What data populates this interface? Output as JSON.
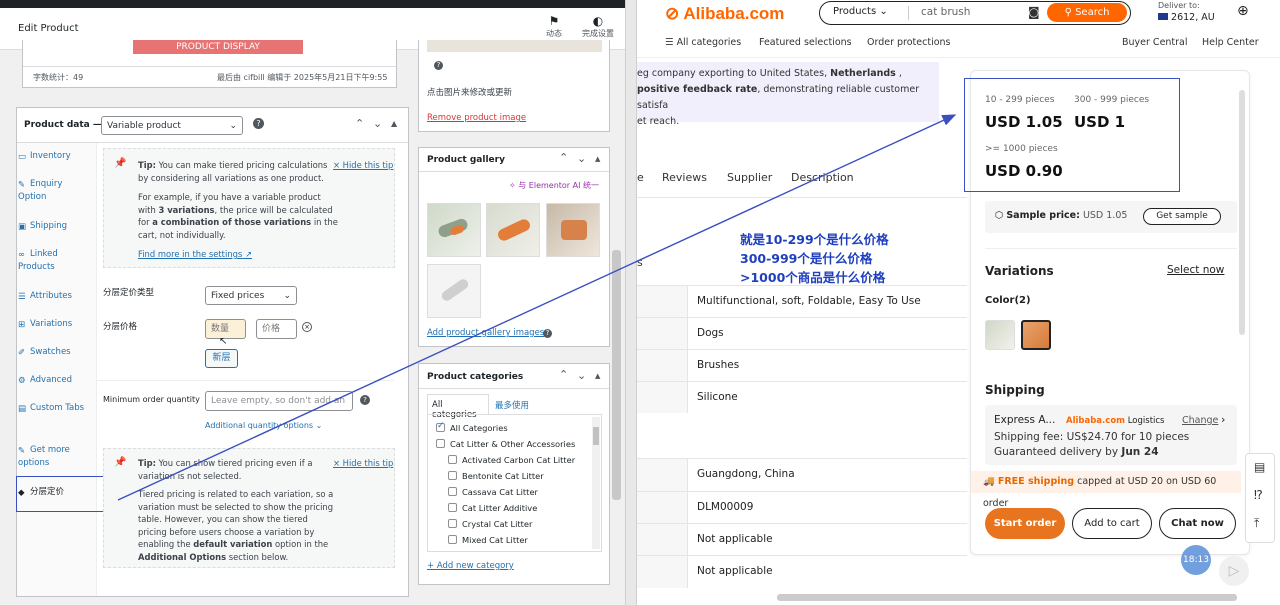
{
  "wp": {
    "header_title": "Edit Product",
    "header_actions": [
      "动态",
      "完成设置"
    ],
    "word_count": "字数统计：49",
    "last_edit": "最后由 cifbill 编辑于 2025年5月21日下午9:55",
    "banner_text": "PRODUCT DISPLAY",
    "product_data_label": "Product data —",
    "product_type": "Variable product",
    "tabs": [
      "Inventory",
      "Enquiry Option",
      "Shipping",
      "Linked Products",
      "Attributes",
      "Variations",
      "Swatches",
      "Advanced",
      "Custom Tabs",
      "Get more options",
      "分层定价"
    ],
    "tip1": {
      "prefix": "Tip:",
      "text": "You can make tiered pricing calculations by considering all variations as one product.",
      "hide": "× Hide this tip",
      "para_a": "For example, if you have a variable product with",
      "bold_a": "3 variations",
      "para_b": ", the price will be calculated for",
      "bold_b": "a combination of those variations",
      "para_c": "in the cart, not individually.",
      "more": "Find more in the settings"
    },
    "tier_type_label": "分层定价类型",
    "tier_type_value": "Fixed prices",
    "tier_price_label": "分层价格",
    "qty_placeholder": "数量",
    "price_placeholder": "价格",
    "new_tier": "新层",
    "min_qty_label": "Minimum order quantity",
    "min_qty_placeholder": "Leave empty, so don't add an",
    "additional_options": "Additional quantity options",
    "tip2": {
      "prefix": "Tip:",
      "text": "You can show tiered pricing even if a variation is not selected.",
      "hide": "× Hide this tip",
      "para": "Tiered pricing is related to each variation, so a variation must be selected to show the pricing table. However, you can show the tiered pricing before users choose a variation by enabling the",
      "bold_a": "default variation",
      "para_b": "option in the",
      "bold_b": "Additional Options",
      "para_c": "section below."
    },
    "image_hint": "点击图片来修改或更新",
    "remove_image": "Remove product image",
    "gallery_title": "Product gallery",
    "elementor": "与 Elementor AI 统一",
    "add_gallery": "Add product gallery images",
    "categories_title": "Product categories",
    "cat_tabs": [
      "All categories",
      "最多使用"
    ],
    "categories": [
      "All Categories",
      "Cat Litter & Other Accessories",
      "Activated Carbon Cat Litter",
      "Bentonite Cat Litter",
      "Cassava Cat Litter",
      "Cat Litter Additive",
      "Crystal Cat Litter",
      "Mixed Cat Litter"
    ],
    "add_category": "+ Add new category"
  },
  "ali": {
    "logo": "Alibaba.com",
    "search_category": "Products",
    "search_query": "cat brush",
    "search_button": "Search",
    "deliver_label": "Deliver to:",
    "deliver_value": "2612, AU",
    "nav": [
      "All categories",
      "Featured selections",
      "Order protections"
    ],
    "nav_right": [
      "Buyer Central",
      "Help Center"
    ],
    "banner_line1_a": "eg company exporting to United States,",
    "banner_line1_b": "Netherlands",
    "banner_line1_c": ",",
    "banner_line2_a": "positive feedback rate",
    "banner_line2_b": ", demonstrating reliable customer satisfa",
    "banner_line3": "et reach.",
    "tabs": [
      "e",
      "Reviews",
      "Supplier",
      "Description"
    ],
    "annotation": [
      "就是10-299个是什么价格",
      "300-999个是什么价格",
      ">1000个商品是什么价格"
    ],
    "spec_rows_top": [
      "Multifunctional, soft, Foldable, Easy To Use",
      "Dogs",
      "Brushes",
      "Silicone"
    ],
    "spec_rows_bottom": [
      "Guangdong, China",
      "DLM00009",
      "Not applicable",
      "Not applicable"
    ],
    "letter_s": "s",
    "price_tiers": [
      {
        "range": "10 - 299 pieces",
        "price": "USD 1.05"
      },
      {
        "range": "300 - 999 pieces",
        "price": "USD 1"
      },
      {
        "range": ">= 1000 pieces",
        "price": "USD 0.90"
      }
    ],
    "sample_label": "Sample price:",
    "sample_value": "USD 1.05",
    "get_sample": "Get sample",
    "variations_title": "Variations",
    "select_now": "Select now",
    "color_label": "Color(2)",
    "shipping_title": "Shipping",
    "express": "Express A...",
    "logistics_brand": "Alibaba.com",
    "logistics_word": "Logistics",
    "change": "Change",
    "shipping_fee": "Shipping fee: US$24.70 for 10 pieces",
    "guaranteed_a": "Guaranteed delivery by",
    "guaranteed_b": "Jun 24",
    "free_ship_a": "FREE shipping",
    "free_ship_b": "capped at USD 20 on USD 60 order",
    "start_order": "Start order",
    "add_to_cart": "Add to cart",
    "chat_now": "Chat now",
    "time_badge": "18:13"
  },
  "colors": {
    "wp_blue": "#2271b1",
    "ali_orange": "#ff6600",
    "annotation_blue": "#1f3fbf",
    "arrow": "#3a4fc0"
  }
}
